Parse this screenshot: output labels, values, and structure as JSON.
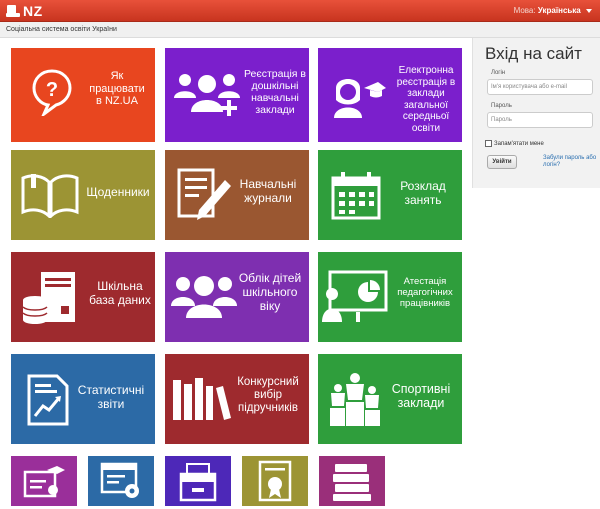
{
  "header": {
    "logo_text": "NZ",
    "language_label": "Мова:",
    "language_value": "Українська"
  },
  "subheader": {
    "text": "Соціальна система освіти України"
  },
  "tiles": [
    {
      "label": "Як працювати в NZ.UA",
      "icon": "speech-question-icon",
      "color": "#e8461f"
    },
    {
      "label": "Реєстрація в дошкільні навчальні заклади",
      "icon": "people-add-icon",
      "color": "#7b1fcc"
    },
    {
      "label": "Електронна реєстрація в заклади загальної середньої освіти",
      "icon": "graduate-icon",
      "color": "#7b1fcc"
    },
    {
      "label": "Щоденники",
      "icon": "open-book-icon",
      "color": "#9c9434"
    },
    {
      "label": "Навчальні журнали",
      "icon": "notebook-pencil-icon",
      "color": "#9a5731"
    },
    {
      "label": "Розклад занять",
      "icon": "calendar-icon",
      "color": "#2f9e3c"
    },
    {
      "label": "Шкільна база даних",
      "icon": "server-database-icon",
      "color": "#9e2a2e"
    },
    {
      "label": "Облік дітей шкільного віку",
      "icon": "group-icon",
      "color": "#7e2fb0"
    },
    {
      "label": "Атестація педагогічних працівників",
      "icon": "presentation-icon",
      "color": "#2f9e3c"
    },
    {
      "label": "Статистичні звіти",
      "icon": "report-chart-icon",
      "color": "#2c6aa6"
    },
    {
      "label": "Конкурсний вибір підручників",
      "icon": "bookshelf-icon",
      "color": "#9e2a2e"
    },
    {
      "label": "Спортивні заклади",
      "icon": "podium-icon",
      "color": "#2f9e3c"
    }
  ],
  "small_tiles": [
    {
      "icon": "diploma-icon",
      "color": "#9a2f9a"
    },
    {
      "icon": "web-settings-icon",
      "color": "#2c6aa6"
    },
    {
      "icon": "archive-drawer-icon",
      "color": "#4d28b8"
    },
    {
      "icon": "certificate-icon",
      "color": "#9c9434"
    },
    {
      "icon": "books-stack-icon",
      "color": "#9a2f7a"
    }
  ],
  "login": {
    "title": "Вхід на сайт",
    "login_label": "Логін",
    "login_placeholder": "Ім'я користувача або e-mail",
    "password_label": "Пароль",
    "password_placeholder": "Пароль",
    "remember_label": "Запам'ятати мене",
    "submit_label": "Увійти",
    "forgot_label": "Забули пароль або логін?"
  }
}
